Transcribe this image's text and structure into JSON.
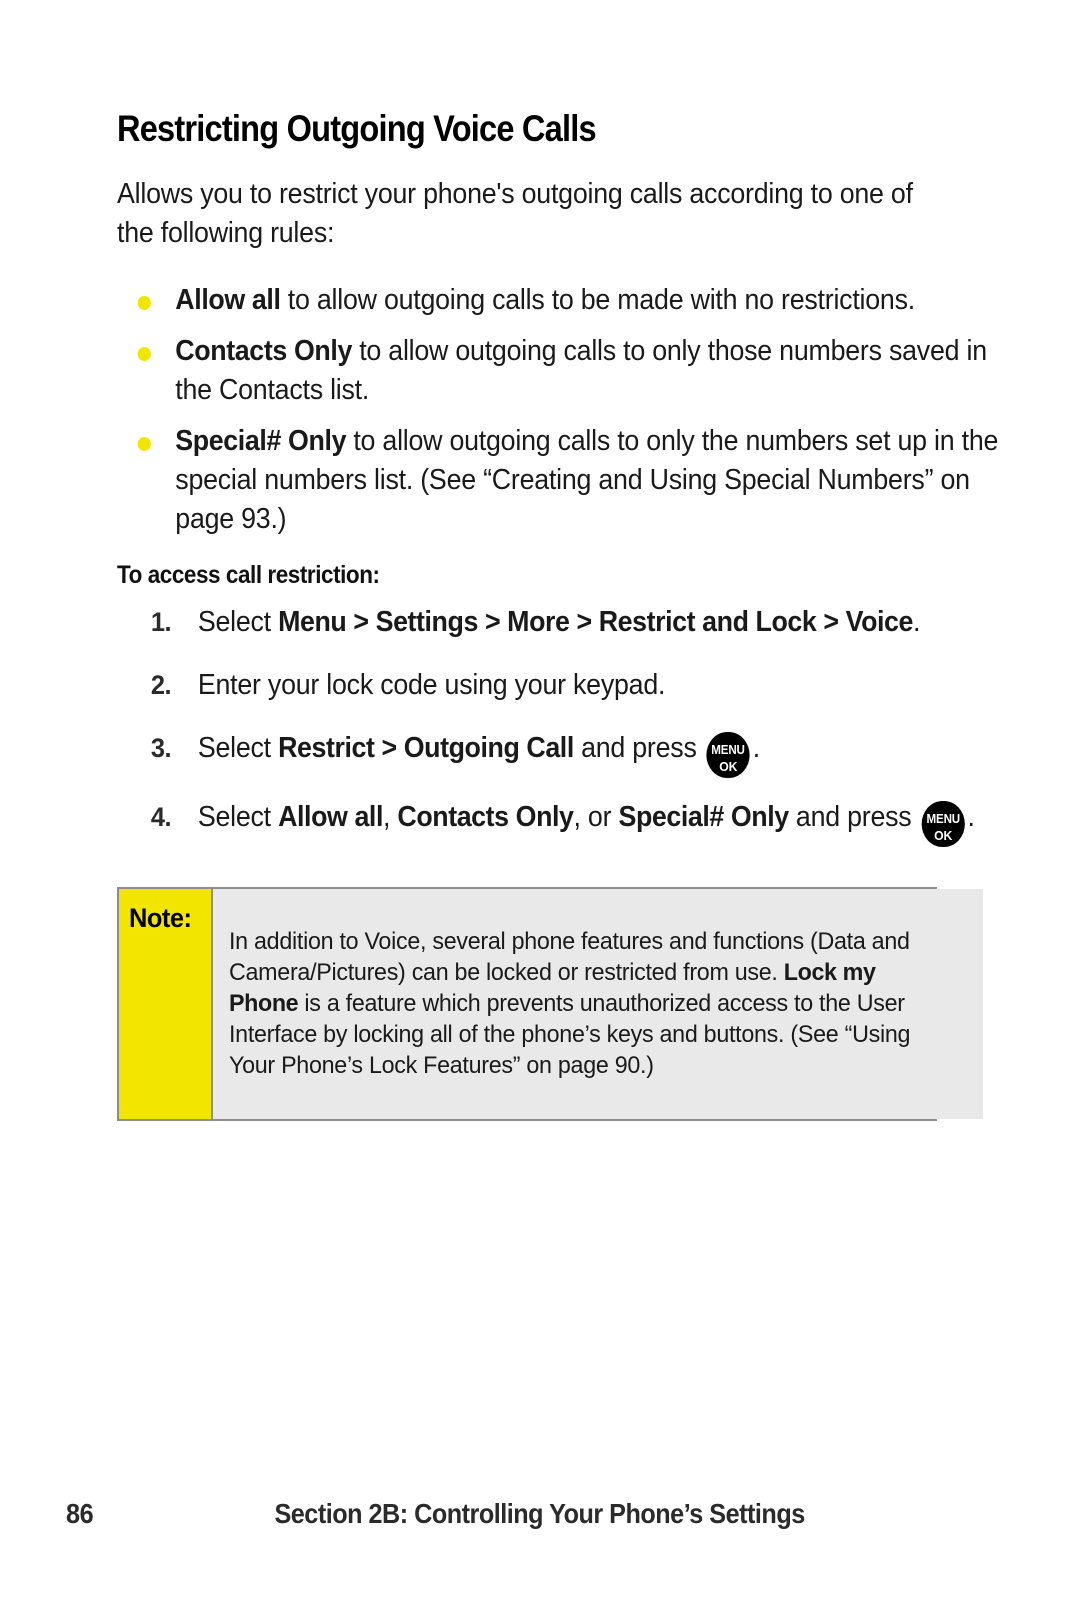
{
  "page": {
    "title": "Restricting Outgoing Voice Calls",
    "intro": "Allows you to restrict your phone's outgoing calls according to one of the following rules:"
  },
  "bullets": [
    {
      "term": "Allow all",
      "rest": " to allow outgoing calls to be made with no restrictions."
    },
    {
      "term": "Contacts Only",
      "rest": " to allow outgoing calls to only those numbers saved in the Contacts list."
    },
    {
      "term": "Special# Only",
      "rest": " to allow outgoing calls to only the numbers set up in the special numbers list. (See “Creating and Using Special Numbers” on page 93.)"
    }
  ],
  "procedure": {
    "heading": "To access call restriction:",
    "steps": [
      {
        "number": "1.",
        "pre": "Select ",
        "bold": "Menu > Settings > More > Restrict and Lock > Voice",
        "post": "."
      },
      {
        "number": "2.",
        "pre": "Enter your lock code using your keypad.",
        "bold": "",
        "post": ""
      },
      {
        "number": "3.",
        "pre": "Select ",
        "bold": "Restrict > Outgoing Call",
        "mid": " and press ",
        "post": "."
      },
      {
        "number": "4.",
        "pre": "Select ",
        "bold1": "Allow all",
        "sep1": ", ",
        "bold2": "Contacts Only",
        "sep2": ", or ",
        "bold3": "Special# Only",
        "mid": " and press ",
        "post": "."
      }
    ]
  },
  "key_icon": {
    "line1": "MENU",
    "line2": "OK"
  },
  "note": {
    "label": "Note:",
    "part1": "In addition to Voice, several phone features and functions (Data and Camera/Pictures) can be locked or restricted from use. ",
    "bold": "Lock my Phone",
    "part2": " is a feature which prevents unauthorized access to the User Interface by locking all of the phone’s keys and buttons. (See “Using Your Phone’s Lock Features” on page 90.)"
  },
  "footer": {
    "page_number": "86",
    "section": "Section 2B: Controlling Your Phone’s Settings"
  },
  "colors": {
    "bullet": "#f2e500",
    "note_label_bg": "#f2e500",
    "note_body_bg": "#e9e9e9",
    "note_border": "#8d8d8d",
    "key_bg": "#000000",
    "text": "#1a1a1a"
  }
}
